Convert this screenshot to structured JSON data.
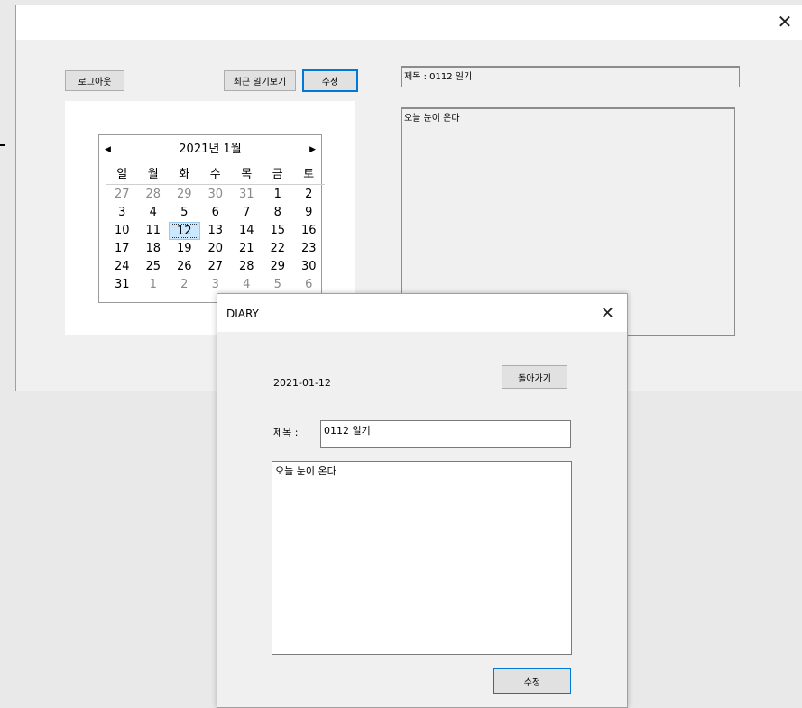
{
  "main": {
    "close_glyph": "✕",
    "logout_label": "로그아웃",
    "recent_diary_label": "최근 일기보기",
    "edit_label": "수정",
    "title_field": "제목 : 0112 일기",
    "content_field": "오늘 눈이 온다"
  },
  "calendar": {
    "month_label": "2021년 1월",
    "prev_glyph": "◀",
    "next_glyph": "▶",
    "weekdays": [
      "일",
      "월",
      "화",
      "수",
      "목",
      "금",
      "토"
    ],
    "days": [
      "27",
      "28",
      "29",
      "30",
      "31",
      "1",
      "2",
      "3",
      "4",
      "5",
      "6",
      "7",
      "8",
      "9",
      "10",
      "11",
      "12",
      "13",
      "14",
      "15",
      "16",
      "17",
      "18",
      "19",
      "20",
      "21",
      "22",
      "23",
      "24",
      "25",
      "26",
      "27",
      "28",
      "29",
      "30",
      "31",
      "1",
      "2",
      "3",
      "4",
      "5",
      "6"
    ],
    "selected_day": "12"
  },
  "dialog": {
    "title": "DIARY",
    "close_glyph": "✕",
    "date": "2021-01-12",
    "back_label": "돌아가기",
    "title_label": "제목 :",
    "title_value": "0112 일기",
    "content_value": "오늘 눈이 온다",
    "edit_label": "수정"
  }
}
